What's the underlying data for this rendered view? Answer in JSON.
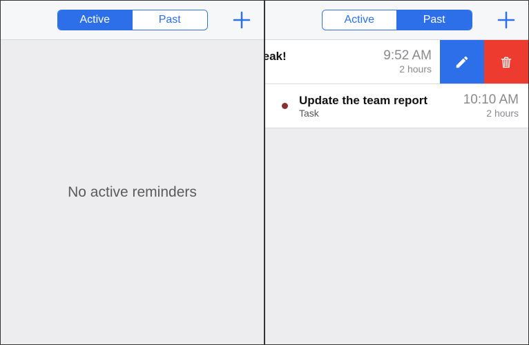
{
  "segments": {
    "active": "Active",
    "past": "Past"
  },
  "left": {
    "selected": "active",
    "empty_message": "No active reminders"
  },
  "right": {
    "selected": "past",
    "rows": [
      {
        "partial_title": "reak!",
        "time": "9:52 AM",
        "duration": "2 hours",
        "swiped": true
      },
      {
        "title": "Update the team report",
        "subtitle": "Task",
        "time": "10:10 AM",
        "duration": "2 hours",
        "swiped": false
      }
    ]
  }
}
